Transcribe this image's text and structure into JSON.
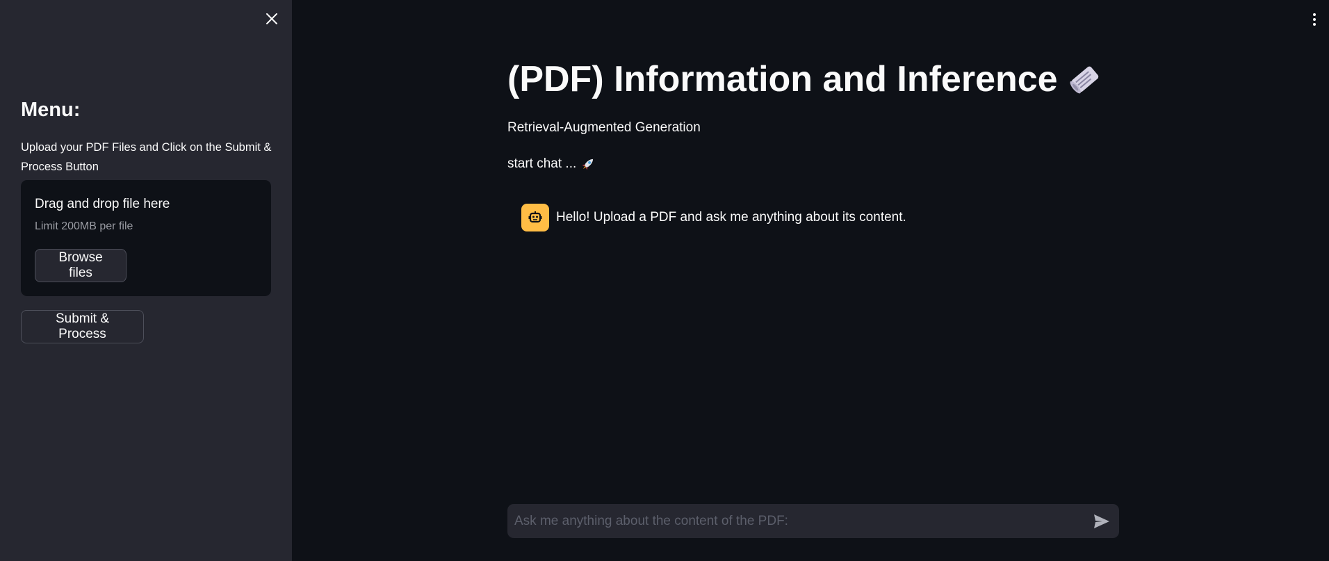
{
  "sidebar": {
    "title": "Menu:",
    "description": "Upload your PDF Files and Click on the Submit & Process Button",
    "uploader": {
      "title": "Drag and drop file here",
      "limit": "Limit 200MB per file",
      "browse_label": "Browse files"
    },
    "submit_label": "Submit & Process",
    "close_icon": "close-icon"
  },
  "main": {
    "title": "(PDF) Information and Inference",
    "title_emoji": "newspaper-roll-icon",
    "subtitle": "Retrieval-Augmented Generation",
    "start_chat": "start chat ...",
    "start_chat_emoji": "rocket-icon",
    "messages": [
      {
        "role": "assistant",
        "avatar_icon": "robot-icon",
        "text": "Hello! Upload a PDF and ask me anything about its content."
      }
    ],
    "chat_input": {
      "placeholder": "Ask me anything about the content of the PDF:",
      "value": ""
    },
    "menu_icon": "kebab-menu-icon"
  },
  "colors": {
    "background": "#0e1117",
    "sidebar": "#262730",
    "avatar": "#ffbd45",
    "text": "#fafafa"
  }
}
